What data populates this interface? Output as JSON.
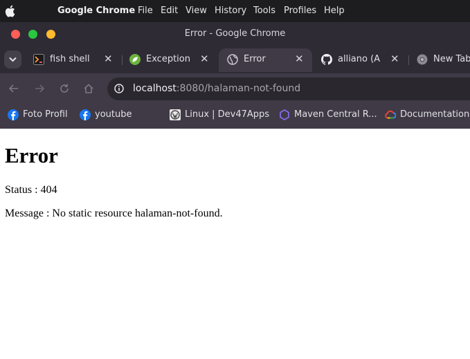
{
  "menubar": {
    "app_name": "Google Chrome",
    "items": [
      "File",
      "Edit",
      "View",
      "History",
      "Tools",
      "Profiles",
      "Help"
    ]
  },
  "window": {
    "title": "Error - Google Chrome"
  },
  "tabs": [
    {
      "title": "fish shell",
      "icon": "terminal-icon"
    },
    {
      "title": "Exception H",
      "icon": "spring-icon"
    },
    {
      "title": "Error",
      "icon": "globe-icon",
      "active": true
    },
    {
      "title": "alliano (Alli",
      "icon": "github-icon"
    },
    {
      "title": "New Tab",
      "icon": "chrome-icon"
    }
  ],
  "toolbar": {
    "url_host": "localhost",
    "url_rest": ":8080/halaman-not-found"
  },
  "bookmarks": [
    {
      "label": "Foto Profil",
      "icon": "facebook-icon"
    },
    {
      "label": "youtube",
      "icon": "facebook-icon"
    },
    {
      "label": "Linux | Dev47Apps",
      "icon": "wordpress-icon"
    },
    {
      "label": "Maven Central R...",
      "icon": "maven-icon"
    },
    {
      "label": "Documentation...",
      "icon": "google-cloud-icon"
    }
  ],
  "page": {
    "heading": "Error",
    "status_line": "Status : 404",
    "message_line": "Message : No static resource halaman-not-found."
  },
  "colors": {
    "menubar_bg": "#1d1d1f",
    "chrome_frame": "#2f2b35",
    "toolbar_bg": "#3f3a46",
    "omnibox_bg": "#2a272f",
    "close_red": "#ff5f57",
    "green": "#28c840",
    "yellow": "#febc2e"
  }
}
